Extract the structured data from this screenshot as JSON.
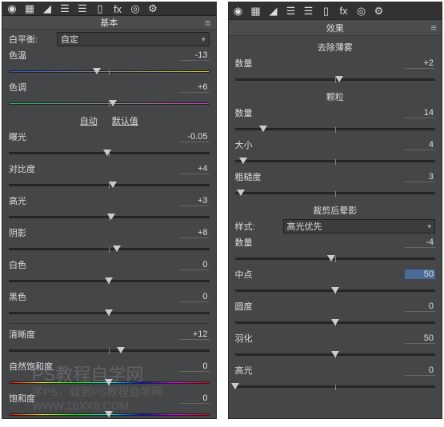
{
  "left": {
    "title": "基本",
    "wb_label": "白平衡:",
    "wb_value": "自定",
    "auto": "自动",
    "default": "默认值",
    "sliders": [
      {
        "name": "色温",
        "value": "-13",
        "pos": 44,
        "track": "temp"
      },
      {
        "name": "色调",
        "value": "+6",
        "pos": 52,
        "track": "tint"
      },
      {
        "name": "曝光",
        "value": "-0.05",
        "pos": 49
      },
      {
        "name": "对比度",
        "value": "+4",
        "pos": 52
      },
      {
        "name": "高光",
        "value": "+3",
        "pos": 51
      },
      {
        "name": "阴影",
        "value": "+8",
        "pos": 54
      },
      {
        "name": "白色",
        "value": "0",
        "pos": 50
      },
      {
        "name": "黑色",
        "value": "0",
        "pos": 50
      },
      {
        "name": "清晰度",
        "value": "+12",
        "pos": 56
      },
      {
        "name": "自然饱和度",
        "value": "0",
        "pos": 50,
        "track": "sat"
      },
      {
        "name": "饱和度",
        "value": "0",
        "pos": 50,
        "track": "sat"
      }
    ]
  },
  "right": {
    "title": "效果",
    "sections": {
      "dehaze": "去除薄雾",
      "grain": "颗粒",
      "vignette": "裁剪后晕影"
    },
    "style_label": "样式:",
    "style_value": "高光优先",
    "sliders": {
      "dehaze_amount": {
        "name": "数量",
        "value": "+2",
        "pos": 52
      },
      "grain_amount": {
        "name": "数量",
        "value": "14",
        "pos": 14
      },
      "grain_size": {
        "name": "大小",
        "value": "4",
        "pos": 4
      },
      "grain_rough": {
        "name": "粗糙度",
        "value": "3",
        "pos": 3
      },
      "vig_amount": {
        "name": "数量",
        "value": "-4",
        "pos": 48
      },
      "vig_mid": {
        "name": "中点",
        "value": "50",
        "pos": 50,
        "sel": true
      },
      "vig_round": {
        "name": "圆度",
        "value": "0",
        "pos": 50
      },
      "vig_feather": {
        "name": "羽化",
        "value": "50",
        "pos": 50
      },
      "vig_highlight": {
        "name": "高光",
        "value": "0",
        "pos": 0
      }
    }
  },
  "watermark": {
    "line1": "PS教程自学网",
    "line2": "学PS，就到PS教程自学网",
    "line3": "WWW.16XX8.COM"
  },
  "icons": [
    "◉",
    "▦",
    "◢",
    "☰",
    "☰",
    "▯",
    "fx",
    "◎",
    "⚙"
  ]
}
